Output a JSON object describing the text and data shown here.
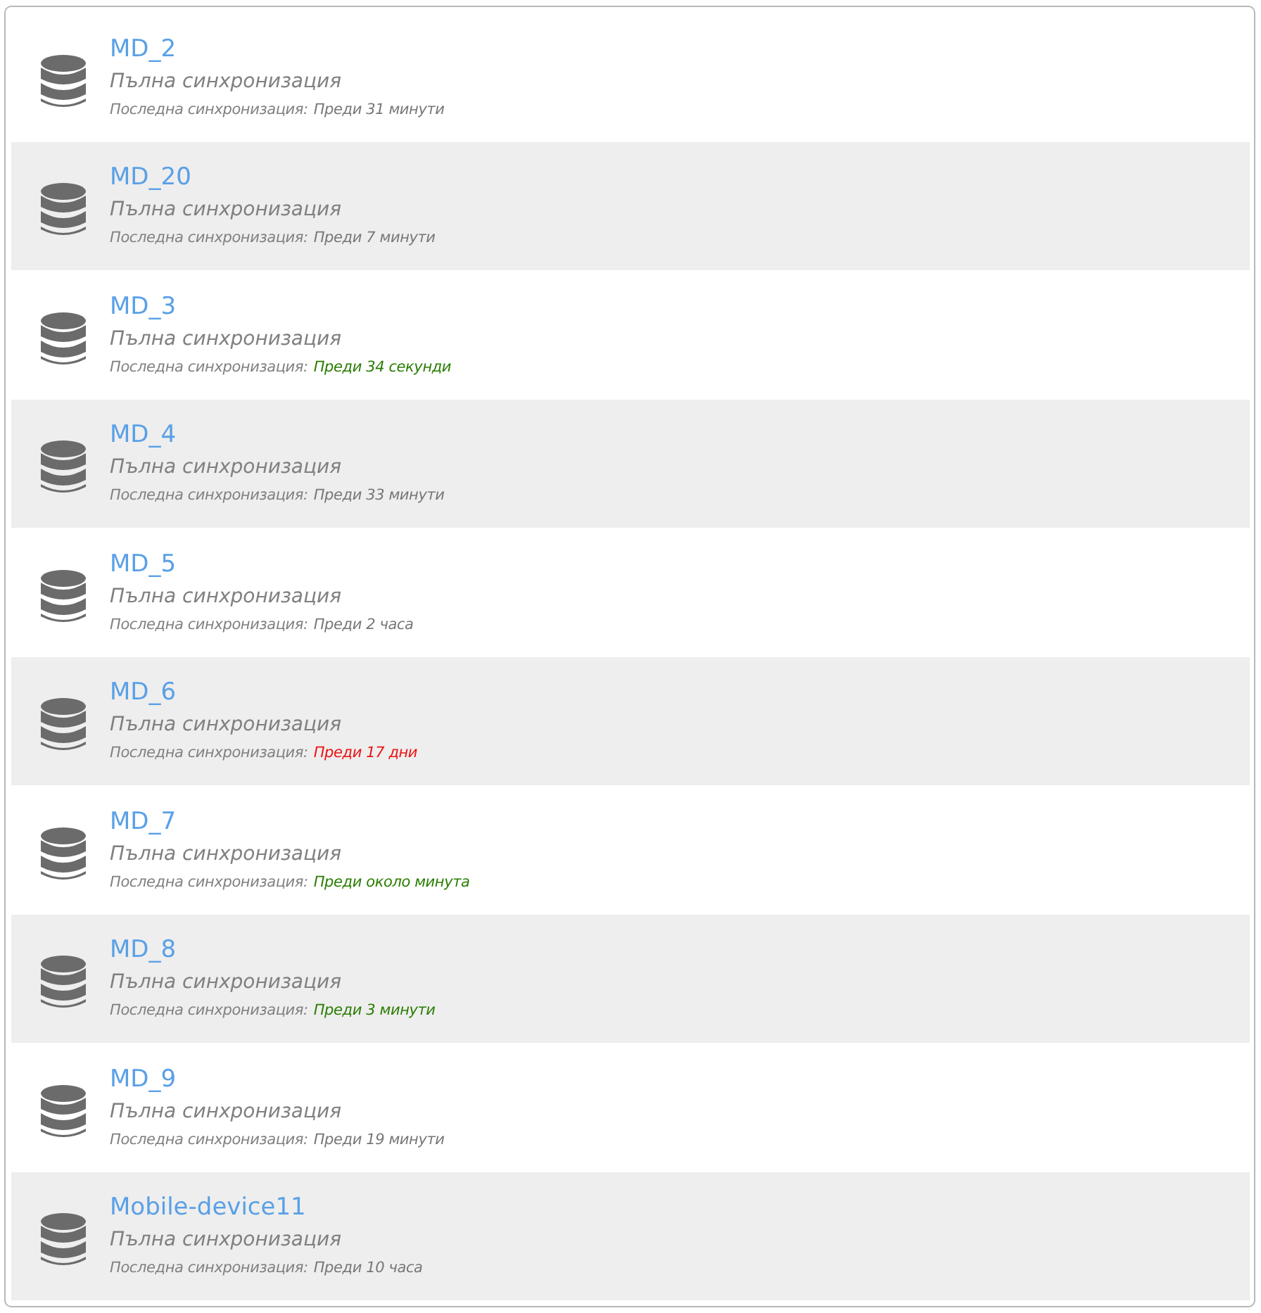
{
  "devices": [
    {
      "name": "MD_2",
      "sync_type": "Пълна синхронизация",
      "last_sync_label": "Последна синхронизация:",
      "last_sync_time": "Преди 31 минути",
      "color": "#777777"
    },
    {
      "name": "MD_20",
      "sync_type": "Пълна синхронизация",
      "last_sync_label": "Последна синхронизация:",
      "last_sync_time": "Преди 7 минути",
      "color": "#777777"
    },
    {
      "name": "MD_3",
      "sync_type": "Пълна синхронизация",
      "last_sync_label": "Последна синхронизация:",
      "last_sync_time": "Преди 34 секунди",
      "color": "#2a7d00"
    },
    {
      "name": "MD_4",
      "sync_type": "Пълна синхронизация",
      "last_sync_label": "Последна синхронизация:",
      "last_sync_time": "Преди 33 минути",
      "color": "#777777"
    },
    {
      "name": "MD_5",
      "sync_type": "Пълна синхронизация",
      "last_sync_label": "Последна синхронизация:",
      "last_sync_time": "Преди 2 часа",
      "color": "#777777"
    },
    {
      "name": "MD_6",
      "sync_type": "Пълна синхронизация",
      "last_sync_label": "Последна синхронизация:",
      "last_sync_time": "Преди 17 дни",
      "color": "#ee1111"
    },
    {
      "name": "MD_7",
      "sync_type": "Пълна синхронизация",
      "last_sync_label": "Последна синхронизация:",
      "last_sync_time": "Преди около минута",
      "color": "#2a7d00"
    },
    {
      "name": "MD_8",
      "sync_type": "Пълна синхронизация",
      "last_sync_label": "Последна синхронизация:",
      "last_sync_time": "Преди 3 минути",
      "color": "#2a7d00"
    },
    {
      "name": "MD_9",
      "sync_type": "Пълна синхронизация",
      "last_sync_label": "Последна синхронизация:",
      "last_sync_time": "Преди 19 минути",
      "color": "#777777"
    },
    {
      "name": "Mobile-device11",
      "sync_type": "Пълна синхронизация",
      "last_sync_label": "Последна синхронизация:",
      "last_sync_time": "Преди 10 часа",
      "color": "#777777"
    }
  ]
}
